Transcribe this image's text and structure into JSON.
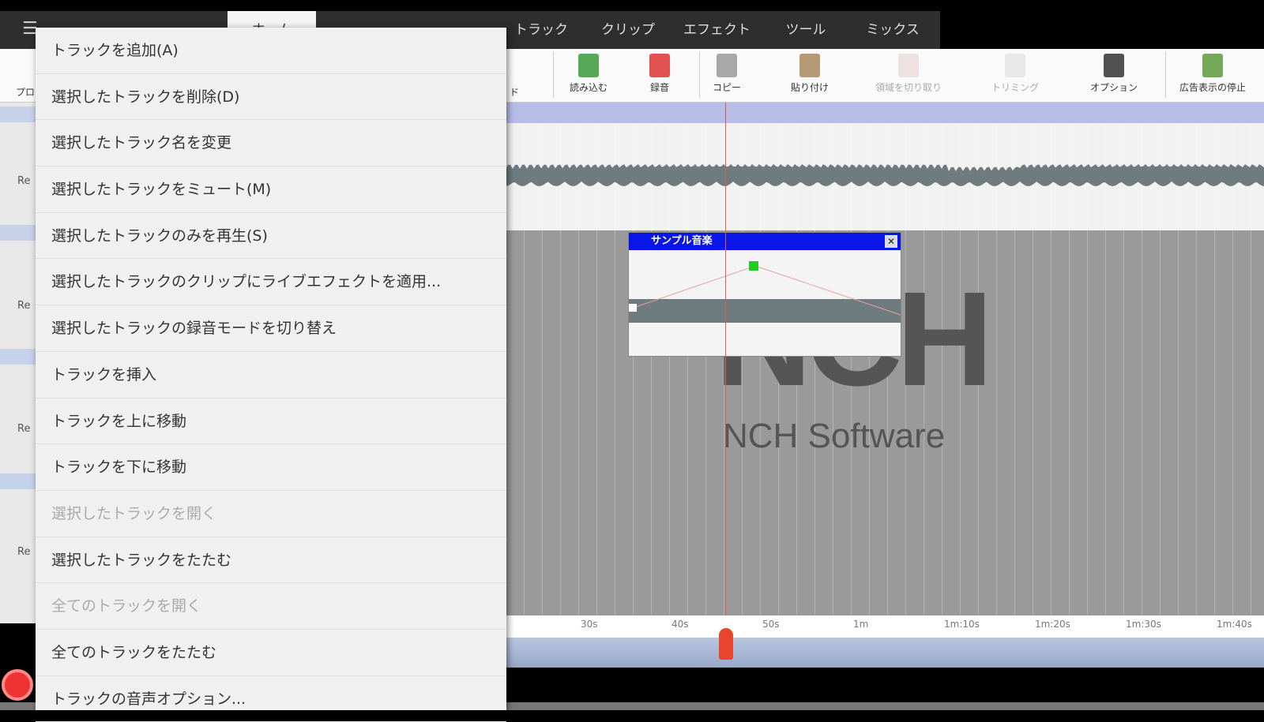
{
  "tabs": [
    "ホーム",
    "トラック",
    "クリップ",
    "エフェクト",
    "ツール",
    "ミックス"
  ],
  "toolbar": [
    {
      "label": "読み込む",
      "icon": "import-icon",
      "color": "#3a9a3a",
      "disabled": false
    },
    {
      "label": "録音",
      "icon": "record-file-icon",
      "color": "#d33",
      "disabled": false
    },
    {
      "label": "コピー",
      "icon": "copy-icon",
      "color": "#999",
      "disabled": false
    },
    {
      "label": "貼り付け",
      "icon": "paste-icon",
      "color": "#a88a5a",
      "disabled": false
    },
    {
      "label": "領域を切り取り",
      "icon": "cut-icon",
      "color": "#dbb",
      "disabled": true
    },
    {
      "label": "トリミング",
      "icon": "trim-icon",
      "color": "#ccc",
      "disabled": true
    },
    {
      "label": "オプション",
      "icon": "options-icon",
      "color": "#333",
      "disabled": false
    },
    {
      "label": "広告表示の停止",
      "icon": "globe-icon",
      "color": "#5a9a3a",
      "disabled": false
    }
  ],
  "toolbar_partial": {
    "left": "プロ",
    "dropdown": "ド"
  },
  "popup": {
    "title": "サンプル音楽",
    "close": "✕"
  },
  "logo": {
    "mark": "NCH",
    "text": "NCH Software"
  },
  "ruler": [
    "30s",
    "40s",
    "50s",
    "1m",
    "1m:10s",
    "1m:20s",
    "1m:30s",
    "1m:40s"
  ],
  "track_label": "Re",
  "menu": [
    {
      "label": "トラックを追加(A)",
      "disabled": false
    },
    {
      "label": "選択したトラックを削除(D)",
      "disabled": false
    },
    {
      "label": "選択したトラック名を変更",
      "disabled": false
    },
    {
      "label": "選択したトラックをミュート(M)",
      "disabled": false
    },
    {
      "label": "選択したトラックのみを再生(S)",
      "disabled": false
    },
    {
      "label": "選択したトラックのクリップにライブエフェクトを適用...",
      "disabled": false
    },
    {
      "label": "選択したトラックの録音モードを切り替え",
      "disabled": false
    },
    {
      "label": "トラックを挿入",
      "disabled": false
    },
    {
      "label": "トラックを上に移動",
      "disabled": false
    },
    {
      "label": "トラックを下に移動",
      "disabled": false
    },
    {
      "label": "選択したトラックを開く",
      "disabled": true
    },
    {
      "label": "選択したトラックをたたむ",
      "disabled": false
    },
    {
      "label": "全てのトラックを開く",
      "disabled": true
    },
    {
      "label": "全てのトラックをたたむ",
      "disabled": false
    },
    {
      "label": "トラックの音声オプション...",
      "disabled": false
    }
  ]
}
